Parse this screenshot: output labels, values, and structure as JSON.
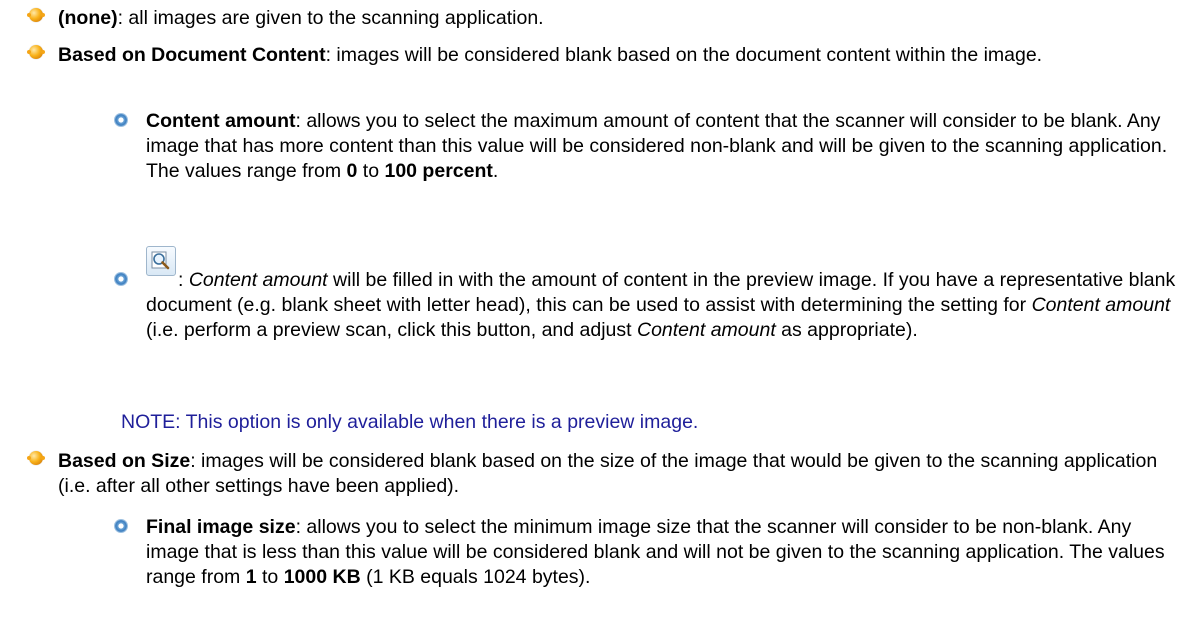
{
  "items": {
    "none": {
      "term": "(none)",
      "text": ": all images are given to the scanning application."
    },
    "content": {
      "term": "Based on Document Content",
      "text": ": images will be considered blank based on the document content within the image.",
      "amount": {
        "term": "Content amount",
        "text1": ": allows you to select the maximum amount of content that the scanner will consider to be blank. Any image that has more content than this value will be considered non-blank and will be given to the scanning application. The values range from ",
        "min": "0",
        "mid": " to ",
        "max": "100 percent",
        "end": "."
      },
      "preview": {
        "colon": ": ",
        "em1": "Content amount",
        "text1": " will be filled in with the amount of content in the preview image. If you have a representative blank document (e.g. blank sheet with letter head), this can be used to assist with determining the setting for ",
        "em2": "Content amount",
        "text2": " (i.e. perform a preview scan, click this button, and adjust ",
        "em3": "Content amount",
        "text3": " as appropriate)."
      },
      "note": "NOTE: This option is only available when there is a preview image."
    },
    "size": {
      "term": "Based on Size",
      "text": ": images will be considered blank based on the size of the image that would be given to the scanning application (i.e. after all other settings have been applied).",
      "final": {
        "term": "Final image size",
        "text1": ": allows you to select the minimum image size that the scanner will consider to be non-blank. Any image that is less than this value will be considered blank and will not be given to the scanning application. The values range from ",
        "min": "1",
        "mid": " to ",
        "max": "1000 KB",
        "end": " (1 KB equals 1024 bytes)."
      }
    }
  },
  "colors": {
    "note": "#1f1f9a",
    "bullet_primary": "#f9b21a",
    "bullet_secondary": "#3d7fc0"
  },
  "icons": {
    "primary_bullet": "orange-bullet-icon",
    "secondary_bullet": "blue-bullet-icon",
    "preview_button": "magnifier-preview-icon"
  }
}
